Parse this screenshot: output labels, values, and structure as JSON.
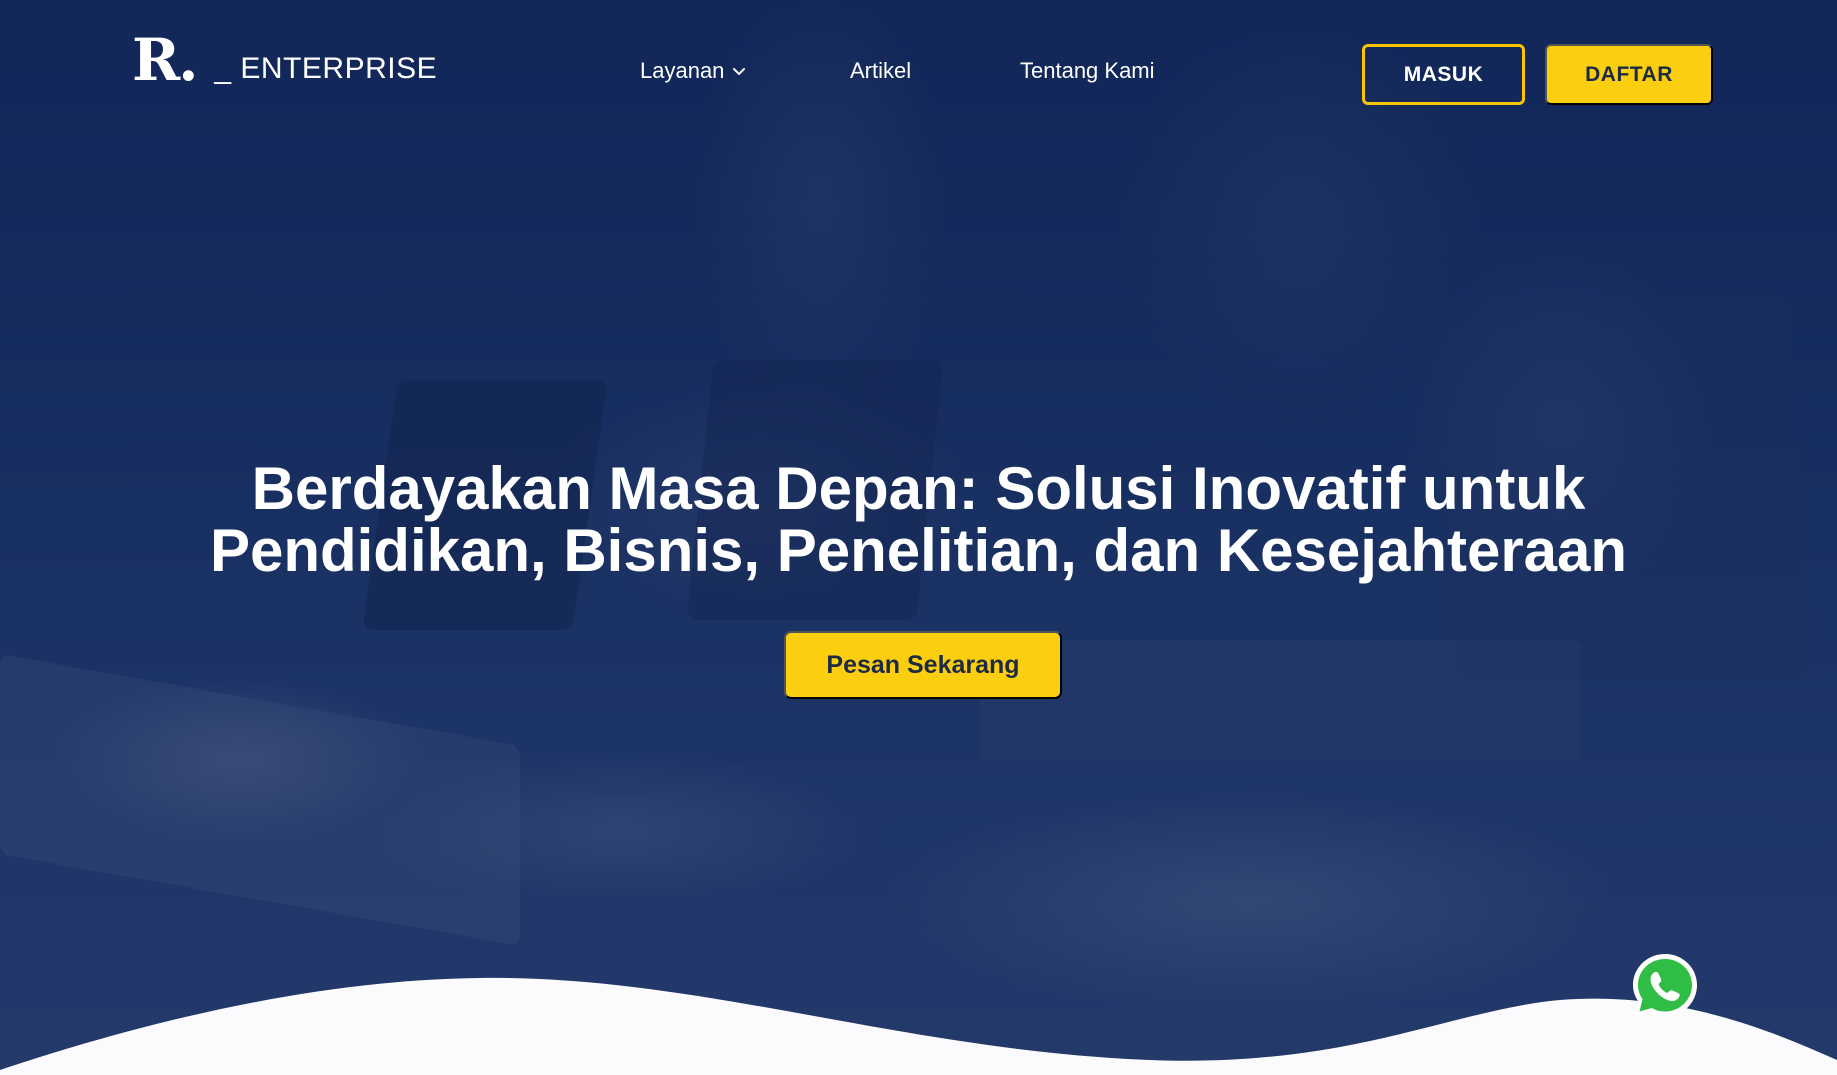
{
  "brand": {
    "logo_mark": "R.",
    "logo_text": "_ ENTERPRISE"
  },
  "nav": {
    "items": [
      {
        "label": "Layanan",
        "has_dropdown": true,
        "icon": "chevron-down-icon"
      },
      {
        "label": "Artikel"
      },
      {
        "label": "Tentang Kami"
      }
    ],
    "login_label": "MASUK",
    "register_label": "DAFTAR"
  },
  "hero": {
    "title_line1": "Berdayakan Masa Depan: Solusi Inovatif untuk",
    "title_line2": "Pendidikan, Bisnis, Penelitian, dan Kesejahteraan",
    "cta_label": "Pesan Sekarang"
  },
  "floating": {
    "whatsapp_icon": "whatsapp-icon"
  },
  "colors": {
    "primary_navy": "#1d3566",
    "accent_yellow": "#fbcf0f",
    "whatsapp_green": "#2fbd45"
  }
}
